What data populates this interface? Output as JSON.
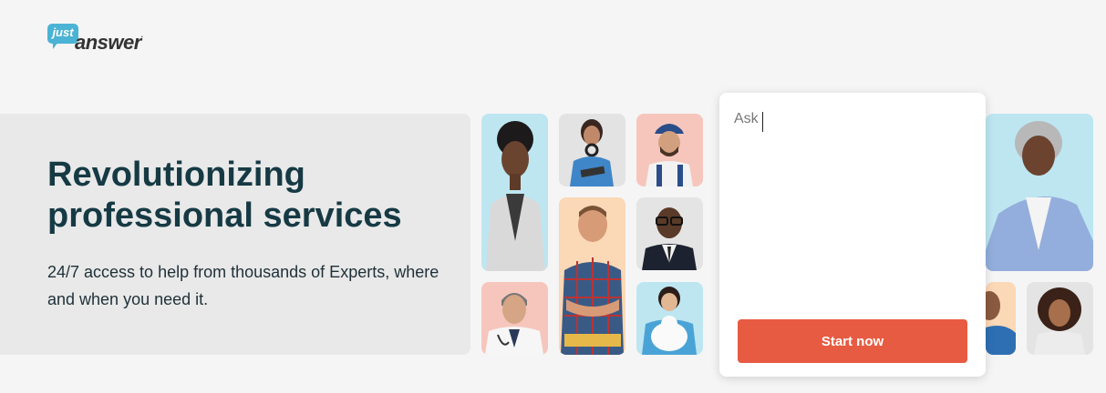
{
  "logo": {
    "top_word": "just",
    "main_word": "answer",
    "mark": "."
  },
  "hero": {
    "title": "Revolutionizing professional services",
    "subtitle": "24/7 access to help from thousands of Experts, where and when you need it."
  },
  "ask": {
    "placeholder": "Ask",
    "button_label": "Start now"
  },
  "tiles": [
    {
      "name": "expert-photo-woman-blazer",
      "bg": "#bde6f1"
    },
    {
      "name": "expert-photo-woman-tablet",
      "bg": "#e3e3e3"
    },
    {
      "name": "expert-photo-mechanic",
      "bg": "#f6c6bd"
    },
    {
      "name": "expert-photo-handyman",
      "bg": "#fbd8b6"
    },
    {
      "name": "expert-photo-man-glasses",
      "bg": "#e4e4e4"
    },
    {
      "name": "expert-photo-doctor",
      "bg": "#f6c6bd"
    },
    {
      "name": "expert-photo-vet-cat",
      "bg": "#bde6f1"
    },
    {
      "name": "expert-photo-woman-smiling",
      "bg": "#bde6f1"
    },
    {
      "name": "expert-photo-man-scrubs",
      "bg": "#fbd8b6"
    },
    {
      "name": "expert-photo-woman-curly",
      "bg": "#e4e4e4"
    }
  ]
}
